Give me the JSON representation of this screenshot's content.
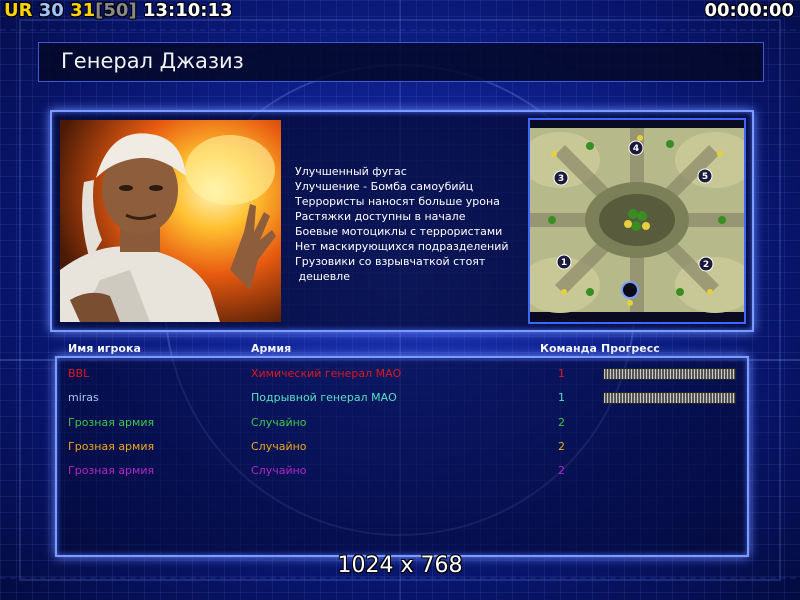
{
  "hud": {
    "brand": "UR",
    "value1": "30",
    "value2": "31",
    "value3": "[50]",
    "clock": "13:10:13",
    "timer": "00:00:00"
  },
  "general": {
    "title": "Генерал Джазиз",
    "perks": [
      "Улучшенный фугас",
      "Улучшение - Бомба самоубийц",
      "Террористы наносят больше урона",
      "Растяжки доступны в начале",
      "Боевые мотоциклы с террористами",
      "Нет маскирующихся подразделений",
      "Грузовики со взрывчаткой стоят",
      " дешевле"
    ]
  },
  "map": {
    "start_positions": [
      "1",
      "2",
      "3",
      "4",
      "5"
    ]
  },
  "players_table": {
    "headers": {
      "name": "Имя игрока",
      "army": "Армия",
      "team": "Команда",
      "progress": "Прогресс"
    },
    "rows": [
      {
        "name": "BBL",
        "army": "Химический генерал МАО",
        "team": "1",
        "color": "#e01818",
        "progress": 1.0
      },
      {
        "name": "miras",
        "army": "Подрывной генерал МАО",
        "team": "1",
        "color": "#a8c8f0",
        "armycolor": "#58e0c0",
        "progress": 1.0
      },
      {
        "name": "Грозная армия",
        "army": "Случайно",
        "team": "2",
        "color": "#3cc848"
      },
      {
        "name": "Грозная армия",
        "army": "Случайно",
        "team": "2",
        "color": "#f0a818"
      },
      {
        "name": "Грозная армия",
        "army": "Случайно",
        "team": "2",
        "color": "#b028c8"
      }
    ]
  },
  "resolution": "1024 x 768",
  "colors": {
    "hud_gold": "#ffd400",
    "hud_blue": "#9fc4ff",
    "frame": "#7a9cff"
  }
}
